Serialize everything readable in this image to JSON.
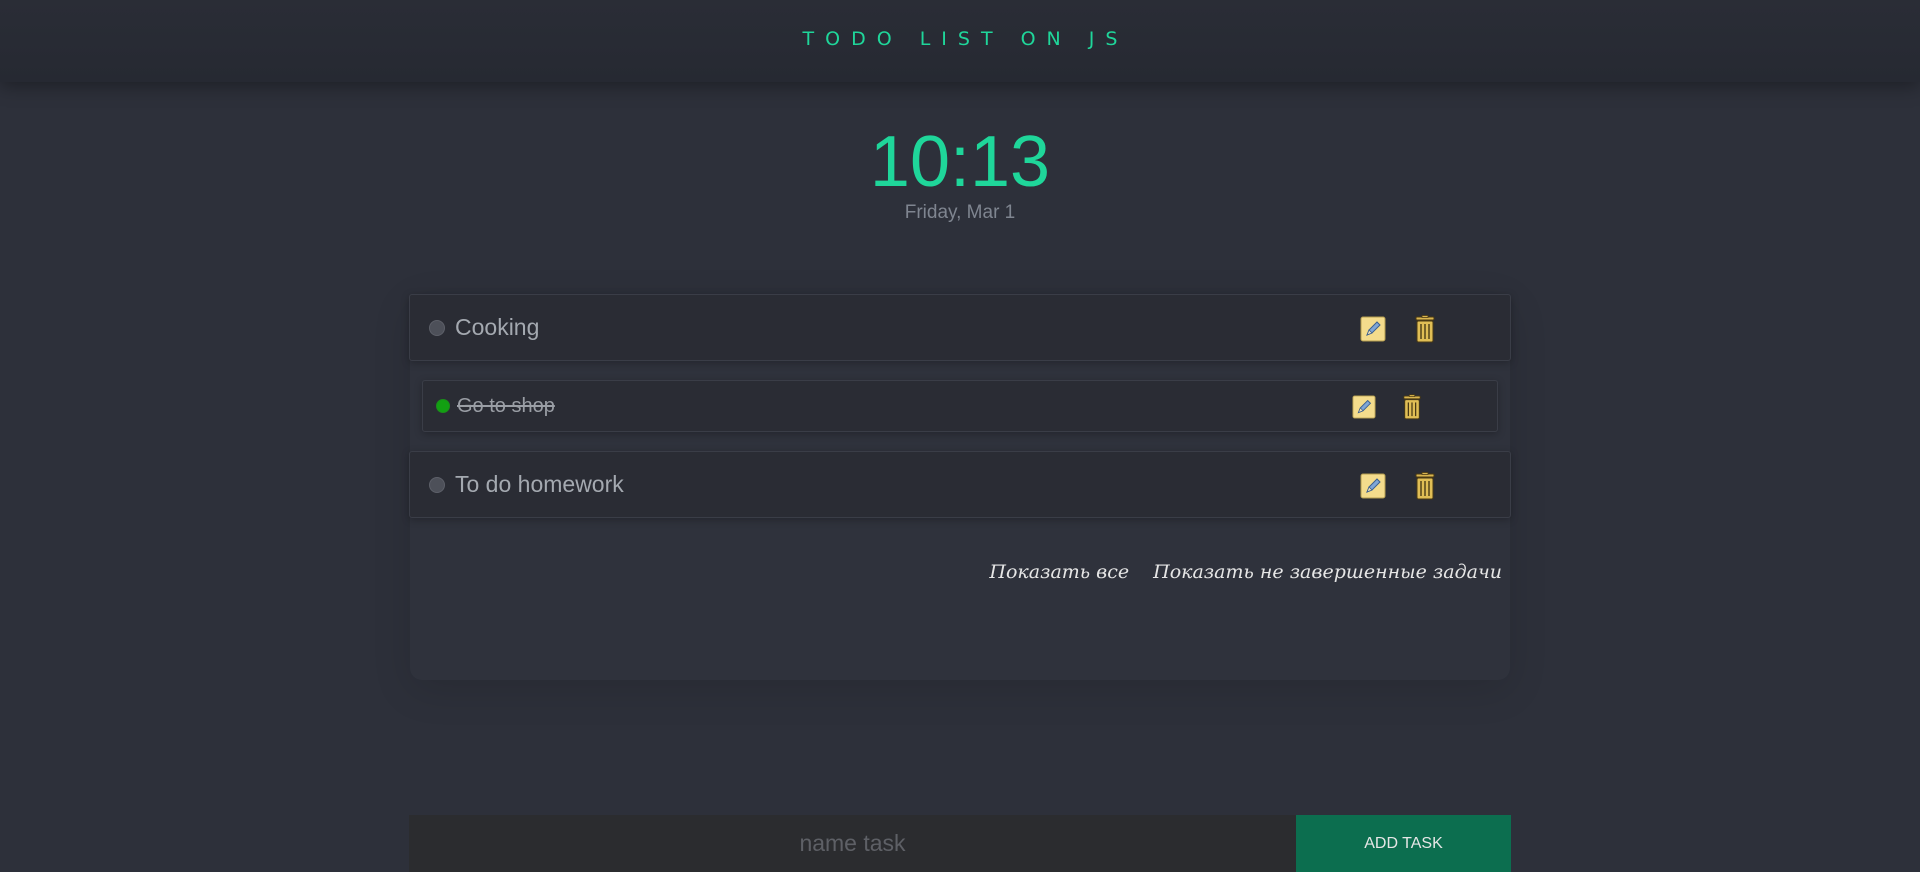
{
  "header": {
    "title": "TODO LIST ON JS"
  },
  "clock": {
    "time": "10:13",
    "date": "Friday, Mar 1"
  },
  "tasks": [
    {
      "label": "Cooking",
      "done": false
    },
    {
      "label": "Go to shop",
      "done": true
    },
    {
      "label": "To do homework",
      "done": false
    }
  ],
  "task_icons": {
    "edit": "pencil-edit-icon",
    "delete": "trash-can-icon"
  },
  "filters": {
    "show_all": "Показать все",
    "show_incomplete": "Показать не завершенные задачи"
  },
  "add_form": {
    "placeholder": "name task",
    "button_label": "ADD TASK"
  },
  "colors": {
    "accent": "#1fd69a",
    "done_dot": "#12a012",
    "add_button": "#0c6e4f",
    "icon_bg": "#f4dc8c"
  }
}
